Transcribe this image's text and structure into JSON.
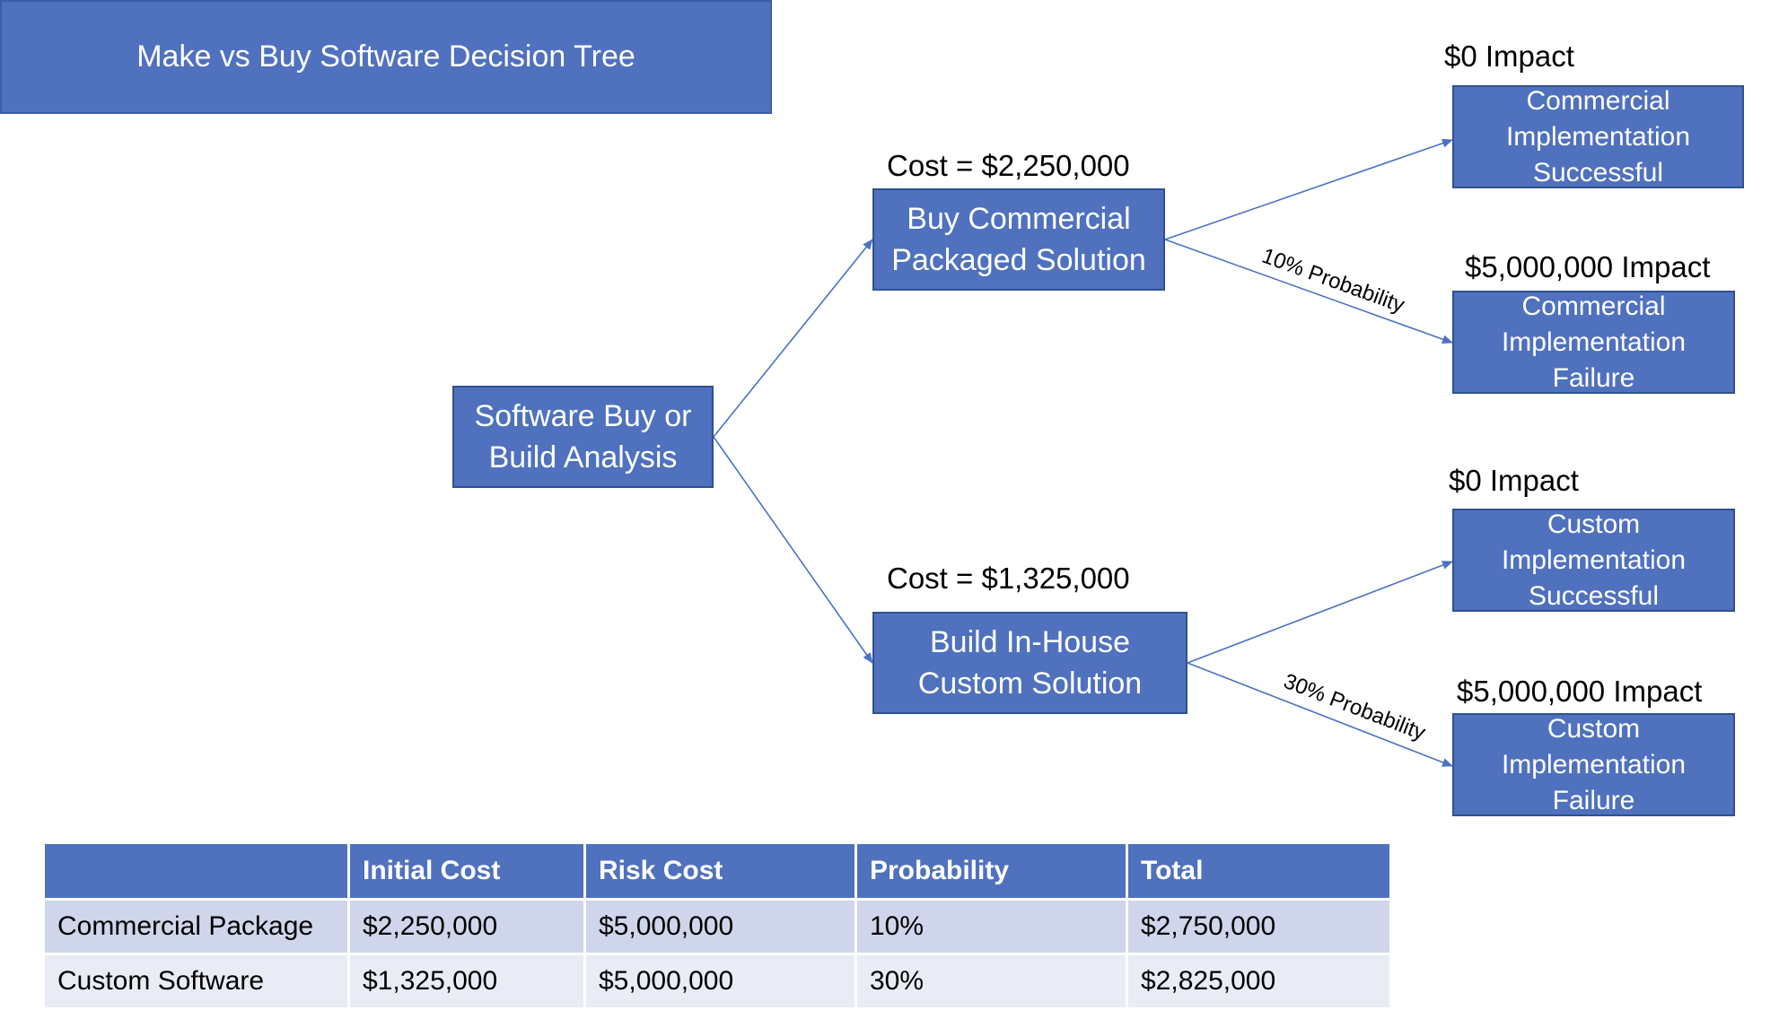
{
  "title": "Make vs Buy Software Decision Tree",
  "colors": {
    "node_fill": "#4F71BE",
    "node_border": "#2F528F",
    "connector": "#4A72C4",
    "row_odd": "#CFD5EA",
    "row_even": "#E9EBF5"
  },
  "tree": {
    "root": {
      "label_line1": "Software Buy or",
      "label_line2": "Build Analysis"
    },
    "buy": {
      "cost_label": "Cost = $2,250,000",
      "label_line1": "Buy Commercial",
      "label_line2": "Packaged Solution",
      "failure_probability_label": "10% Probability",
      "success": {
        "impact": "$0 Impact",
        "line1": "Commercial",
        "line2": "Implementation",
        "line3": "Successful"
      },
      "failure": {
        "impact": "$5,000,000 Impact",
        "line1": "Commercial",
        "line2": "Implementation",
        "line3": "Failure"
      }
    },
    "build": {
      "cost_label": "Cost = $1,325,000",
      "label_line1": "Build In-House",
      "label_line2": "Custom Solution",
      "failure_probability_label": "30% Probability",
      "success": {
        "impact": "$0 Impact",
        "line1": "Custom",
        "line2": "Implementation",
        "line3": "Successful"
      },
      "failure": {
        "impact": "$5,000,000 Impact",
        "line1": "Custom",
        "line2": "Implementation",
        "line3": "Failure"
      }
    }
  },
  "table": {
    "headers": [
      "",
      "Initial Cost",
      "Risk Cost",
      "Probability",
      "Total"
    ],
    "rows": [
      [
        "Commercial Package",
        "$2,250,000",
        "$5,000,000",
        "10%",
        "$2,750,000"
      ],
      [
        "Custom Software",
        "$1,325,000",
        "$5,000,000",
        "30%",
        "$2,825,000"
      ]
    ]
  }
}
